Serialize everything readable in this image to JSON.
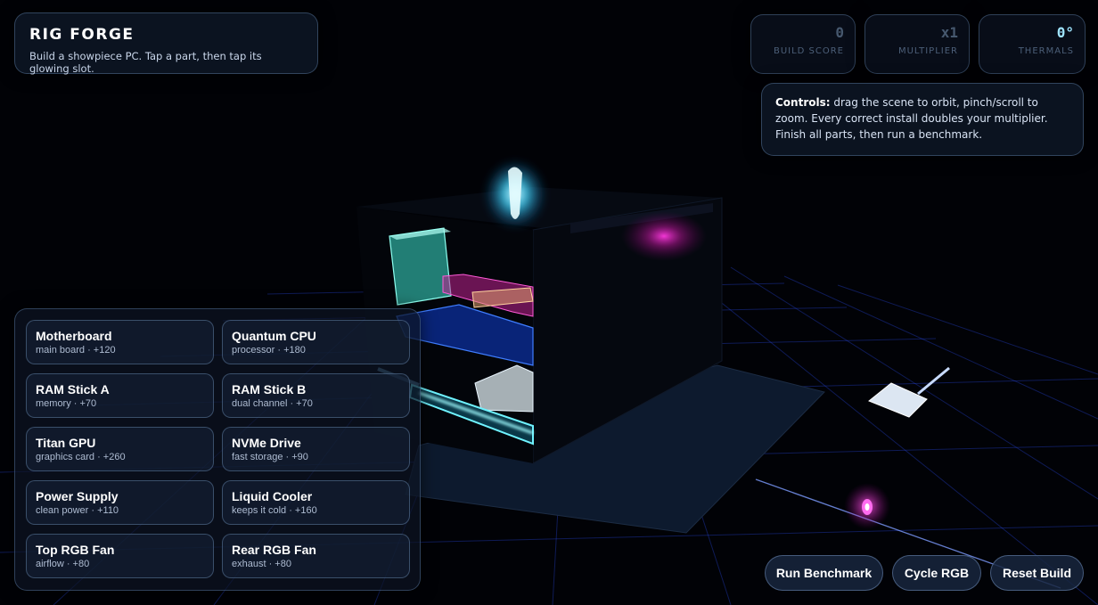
{
  "title": {
    "name": "RIG FORGE",
    "subtitle": "Build a showpiece PC. Tap a part, then tap its glowing slot."
  },
  "stats": [
    {
      "value": "0",
      "label": "BUILD SCORE"
    },
    {
      "value": "x1",
      "label": "MULTIPLIER"
    },
    {
      "value": "0°",
      "label": "THERMALS"
    }
  ],
  "controls": {
    "heading": "Controls:",
    "text": " drag the scene to orbit, pinch/scroll to zoom. Every correct install doubles your multiplier. Finish all parts, then run a benchmark."
  },
  "parts": [
    {
      "name": "Motherboard",
      "meta": "main board · +120"
    },
    {
      "name": "Quantum CPU",
      "meta": "processor · +180"
    },
    {
      "name": "RAM Stick A",
      "meta": "memory · +70"
    },
    {
      "name": "RAM Stick B",
      "meta": "dual channel · +70"
    },
    {
      "name": "Titan GPU",
      "meta": "graphics card · +260"
    },
    {
      "name": "NVMe Drive",
      "meta": "fast storage · +90"
    },
    {
      "name": "Power Supply",
      "meta": "clean power · +110"
    },
    {
      "name": "Liquid Cooler",
      "meta": "keeps it cold · +160"
    },
    {
      "name": "Top RGB Fan",
      "meta": "airflow · +80"
    },
    {
      "name": "Rear RGB Fan",
      "meta": "exhaust · +80"
    }
  ],
  "buttons": {
    "benchmark": "Run Benchmark",
    "cycle": "Cycle RGB",
    "reset": "Reset Build"
  },
  "colors": {
    "accent_cyan": "#49e6ff",
    "accent_magenta": "#ff2bd6",
    "grid_blue": "#3a5cff",
    "panel_bg": "#0e1828"
  }
}
